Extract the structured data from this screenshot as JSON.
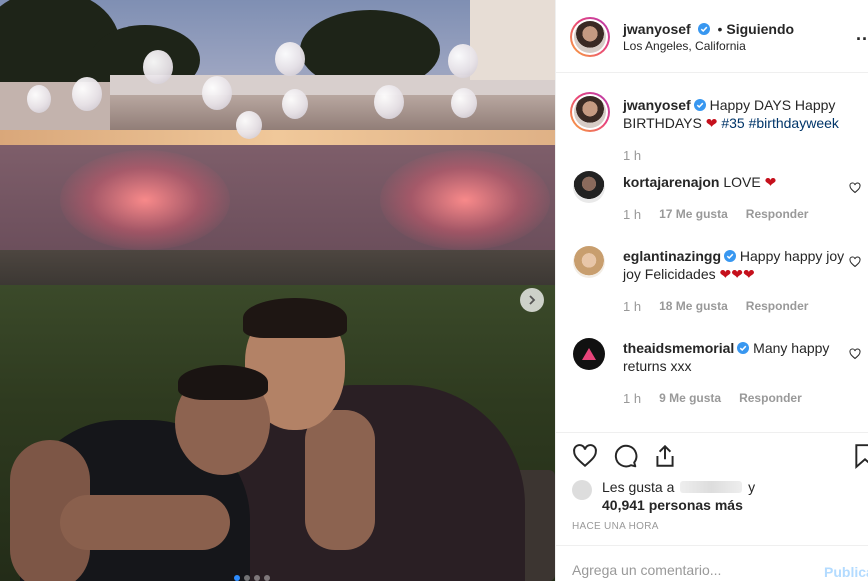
{
  "post": {
    "image_alt": "",
    "carousel_dots": 4
  },
  "header": {
    "username": "jwanyosef",
    "separator": "•",
    "follow_status": "Siguiendo",
    "location": "Los Angeles, California",
    "more": "..."
  },
  "caption": {
    "username": "jwanyosef",
    "text_pre": "Happy DAYS Happy BIRTHDAYS",
    "heart": "❤",
    "tag1": "#35",
    "tag2": "#birthdayweek",
    "time": "1 h"
  },
  "comments": [
    {
      "username": "kortajarenajon",
      "text": "LOVE",
      "heart": "❤",
      "time": "1 h",
      "likes": "17 Me gusta",
      "reply": "Responder"
    },
    {
      "username": "eglantinazingg",
      "text": "Happy happy joy joy Felicidades",
      "heart": "❤❤❤",
      "time": "1 h",
      "likes": "18 Me gusta",
      "reply": "Responder"
    },
    {
      "username": "theaidsmemorial",
      "text": "Many happy returns xxx",
      "heart": "",
      "time": "1 h",
      "likes": "9 Me gusta",
      "reply": "Responder"
    }
  ],
  "likes": {
    "prefix": "Les gusta a",
    "suffix": "y",
    "count_text": "40,941 personas más"
  },
  "time_ago": "HACE UNA HORA",
  "add_comment": {
    "placeholder": "Agrega un comentario...",
    "publish": "Publicar"
  },
  "colors": {
    "verified": "#3897f0",
    "heart": "#c5101c",
    "hashtag": "#003569",
    "publish_disabled": "#b3dbff"
  }
}
